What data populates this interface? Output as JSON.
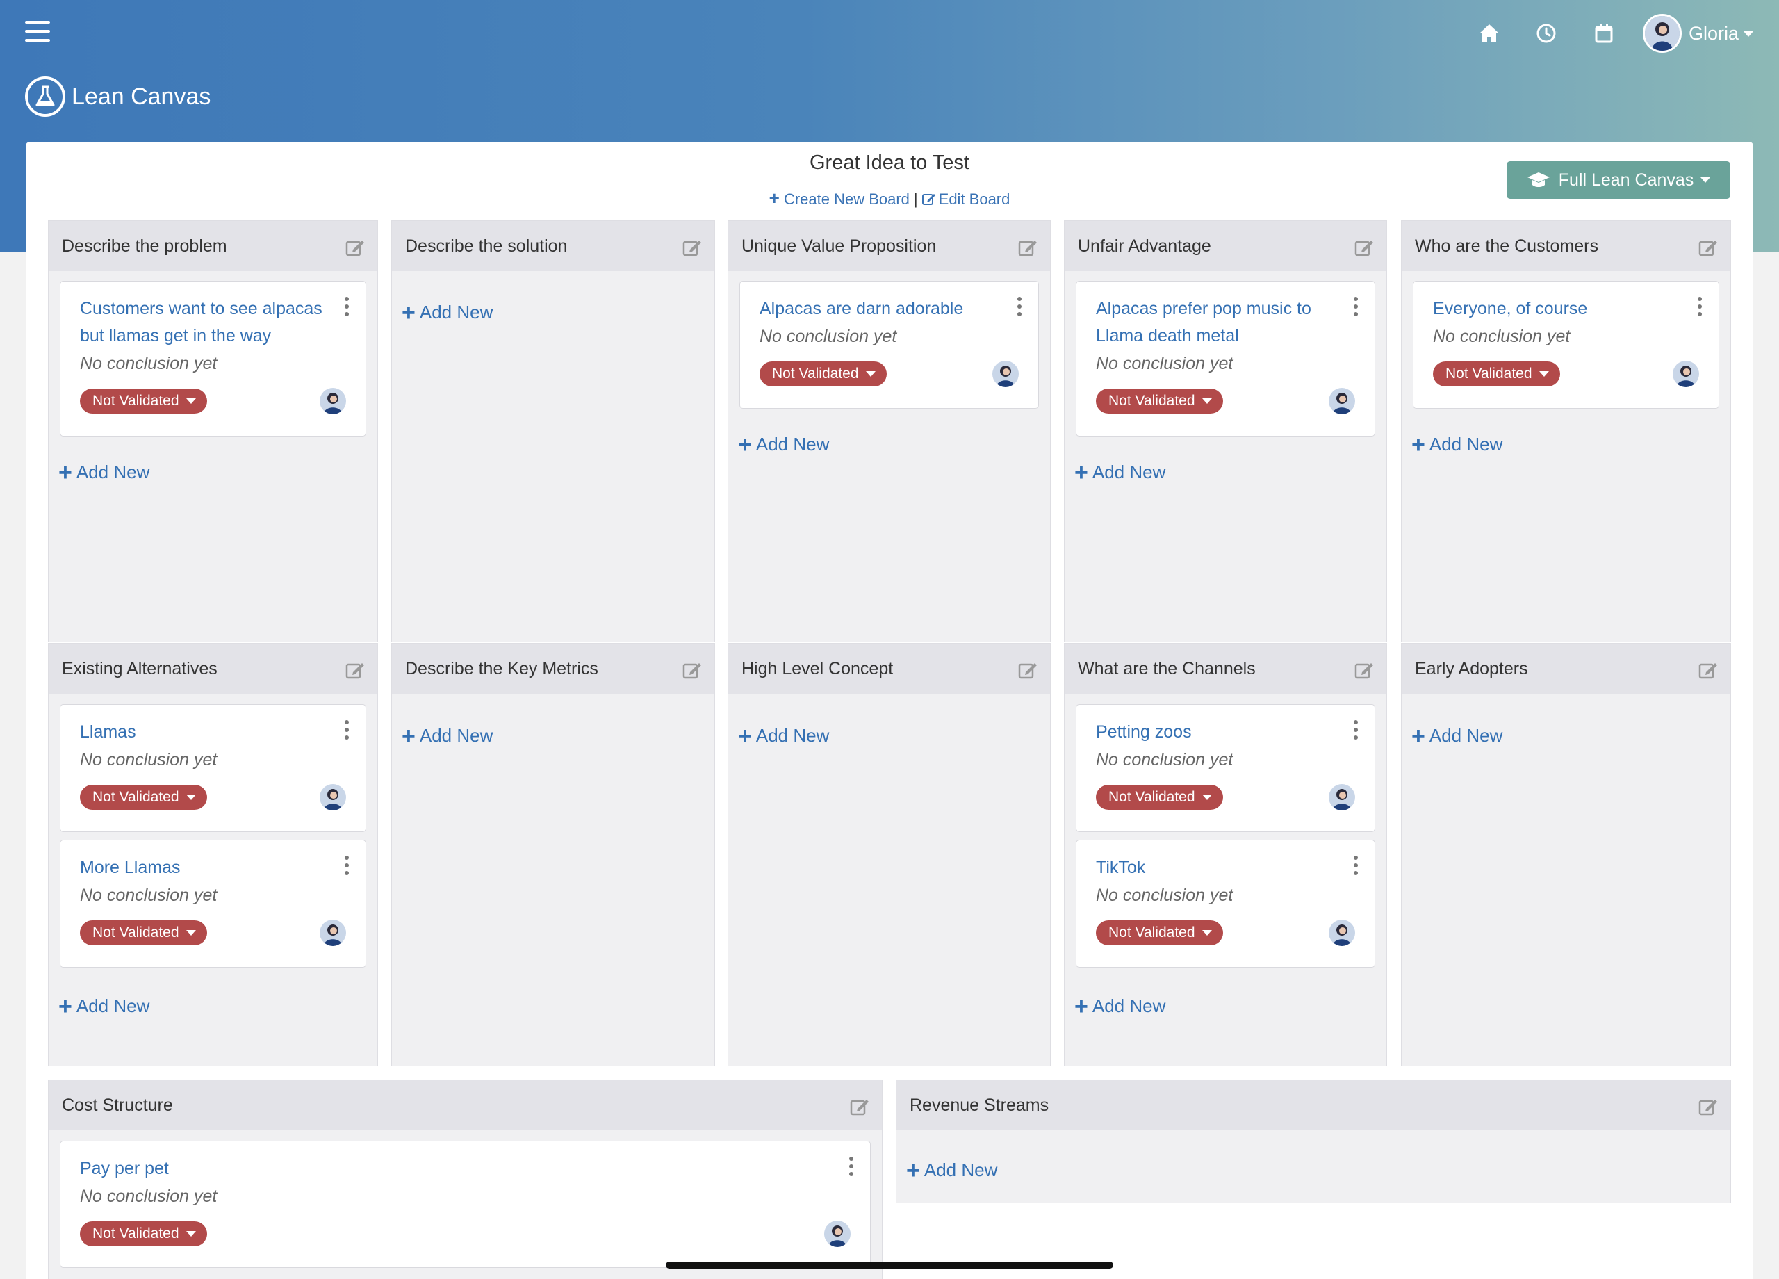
{
  "header": {
    "menu_icon": "hamburger-menu-icon",
    "icons": [
      "home-icon",
      "clock-icon",
      "calendar-icon"
    ],
    "user_name": "Gloria",
    "app_icon": "flask-icon",
    "app_title": "Lean Canvas"
  },
  "board": {
    "title": "Great Idea to Test",
    "create_link": "Create New Board",
    "separator": "|",
    "edit_link": "Edit Board",
    "full_button": "Full Lean Canvas",
    "full_button_icon": "graduation-cap-icon"
  },
  "common": {
    "add_new": "Add New",
    "status": "Not Validated",
    "conclusion": "No conclusion yet",
    "status_color": "#b24a4a",
    "link_color": "#3470b3"
  },
  "columns": [
    {
      "title": "Describe the problem",
      "cards": [
        {
          "title": "Customers want to see alpacas but llamas get in the way"
        }
      ]
    },
    {
      "title": "Describe the solution",
      "cards": []
    },
    {
      "title": "Unique Value Proposition",
      "cards": [
        {
          "title": "Alpacas are darn adorable"
        }
      ]
    },
    {
      "title": "Unfair Advantage",
      "cards": [
        {
          "title": "Alpacas prefer pop music to Llama death metal"
        }
      ]
    },
    {
      "title": "Who are the Customers",
      "cards": [
        {
          "title": "Everyone, of course"
        }
      ]
    },
    {
      "title": "Existing Alternatives",
      "cards": [
        {
          "title": "Llamas"
        },
        {
          "title": "More Llamas"
        }
      ]
    },
    {
      "title": "Describe the Key Metrics",
      "cards": []
    },
    {
      "title": "High Level Concept",
      "cards": []
    },
    {
      "title": "What are the Channels",
      "cards": [
        {
          "title": "Petting zoos"
        },
        {
          "title": "TikTok"
        }
      ]
    },
    {
      "title": "Early Adopters",
      "cards": []
    },
    {
      "title": "Cost Structure",
      "cards": [
        {
          "title": "Pay per pet"
        }
      ]
    },
    {
      "title": "Revenue Streams",
      "cards": []
    }
  ]
}
